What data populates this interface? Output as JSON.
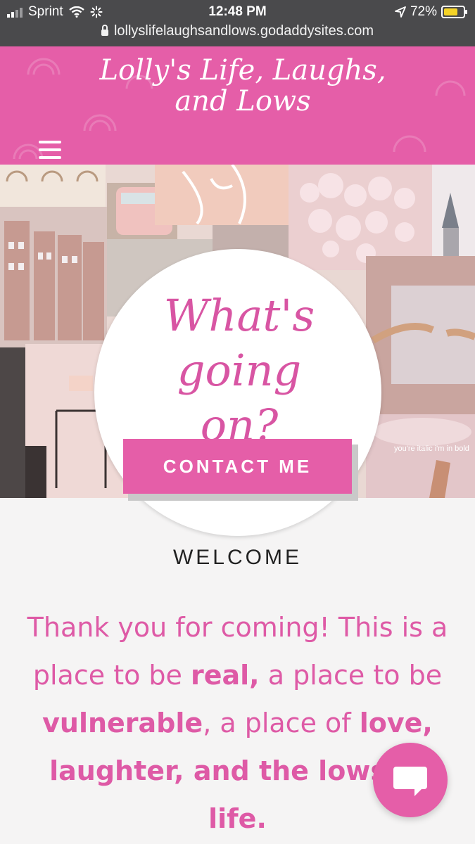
{
  "statusbar": {
    "carrier": "Sprint",
    "time": "12:48 PM",
    "battery": "72%",
    "battery_level": 0.72,
    "url": "lollyslifelaughsandlows.godaddysites.com"
  },
  "header": {
    "title_line1": "Lolly's Life, Laughs,",
    "title_line2": "and Lows",
    "menu_icon": "hamburger-menu-icon"
  },
  "hero": {
    "heading_line1": "What's",
    "heading_line2": "going on?",
    "cta_label": "CONTACT ME",
    "collage_caption": "you're italic i'm in bold"
  },
  "welcome": {
    "label": "WELCOME",
    "intro": {
      "p1": "Thank you for coming! This is a place to be ",
      "b1": "real,",
      "p2": " a place to be ",
      "b2": "vulnerable",
      "p3": ", a place of ",
      "b3": "love, laughter, and the lows of life."
    }
  },
  "chat": {
    "icon": "chat-bubble-icon"
  },
  "colors": {
    "brand_pink": "#e55ea8",
    "text_pink": "#de5aa6",
    "status_bar": "#4a4a4c"
  }
}
